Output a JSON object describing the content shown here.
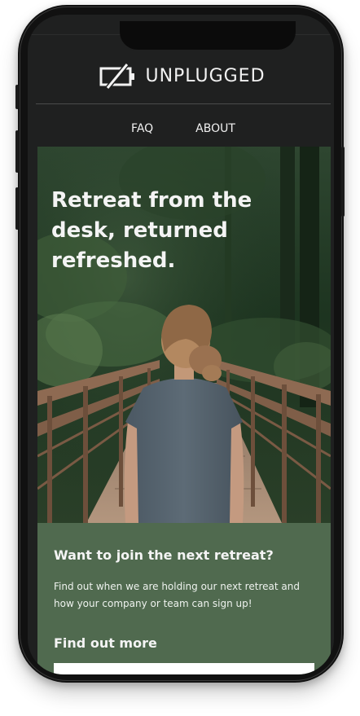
{
  "brand": {
    "name": "UNPLUGGED",
    "logo_icon": "crossed-out-battery-icon"
  },
  "nav": {
    "items": [
      {
        "label": "FAQ"
      },
      {
        "label": "ABOUT"
      }
    ]
  },
  "hero": {
    "title": "Retreat from the desk, returned refreshed.",
    "image": "woman-on-forest-bridge-photo"
  },
  "cta": {
    "heading": "Want to join the next retreat?",
    "text": "Find out when we are holding our next retreat and how your company or team can sign up!",
    "link_label": "Find out more"
  },
  "colors": {
    "header_bg": "#1f2020",
    "panel_green": "#506a4f",
    "text_light": "#f4f4f4"
  }
}
